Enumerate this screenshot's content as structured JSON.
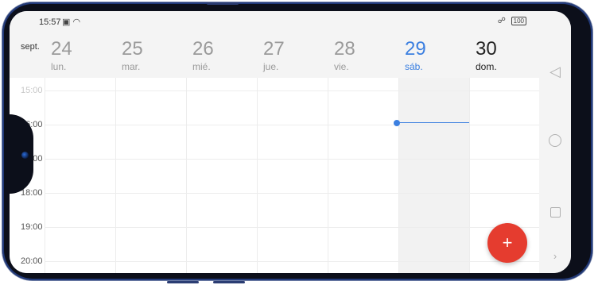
{
  "status_bar": {
    "time": "15:57",
    "battery": "100"
  },
  "header": {
    "month": "sept.",
    "days": [
      {
        "num": "24",
        "weekday": "lun."
      },
      {
        "num": "25",
        "weekday": "mar."
      },
      {
        "num": "26",
        "weekday": "mié."
      },
      {
        "num": "27",
        "weekday": "jue."
      },
      {
        "num": "28",
        "weekday": "vie."
      },
      {
        "num": "29",
        "weekday": "sáb."
      },
      {
        "num": "30",
        "weekday": "dom."
      }
    ]
  },
  "times": [
    "15:00",
    "16:00",
    "17:00",
    "18:00",
    "19:00",
    "20:00"
  ],
  "fab": {
    "label": "+"
  },
  "icons": {
    "status_notification": "image-icon",
    "status_wifi": "wifi-icon",
    "status_extra": "vpn-icon",
    "nav_back": "back-triangle-icon",
    "nav_home": "home-circle-icon",
    "nav_recent": "recent-square-icon",
    "nav_more": "chevron-right-icon"
  },
  "colors": {
    "accent": "#3b7fe0",
    "fab": "#e53c2f"
  }
}
